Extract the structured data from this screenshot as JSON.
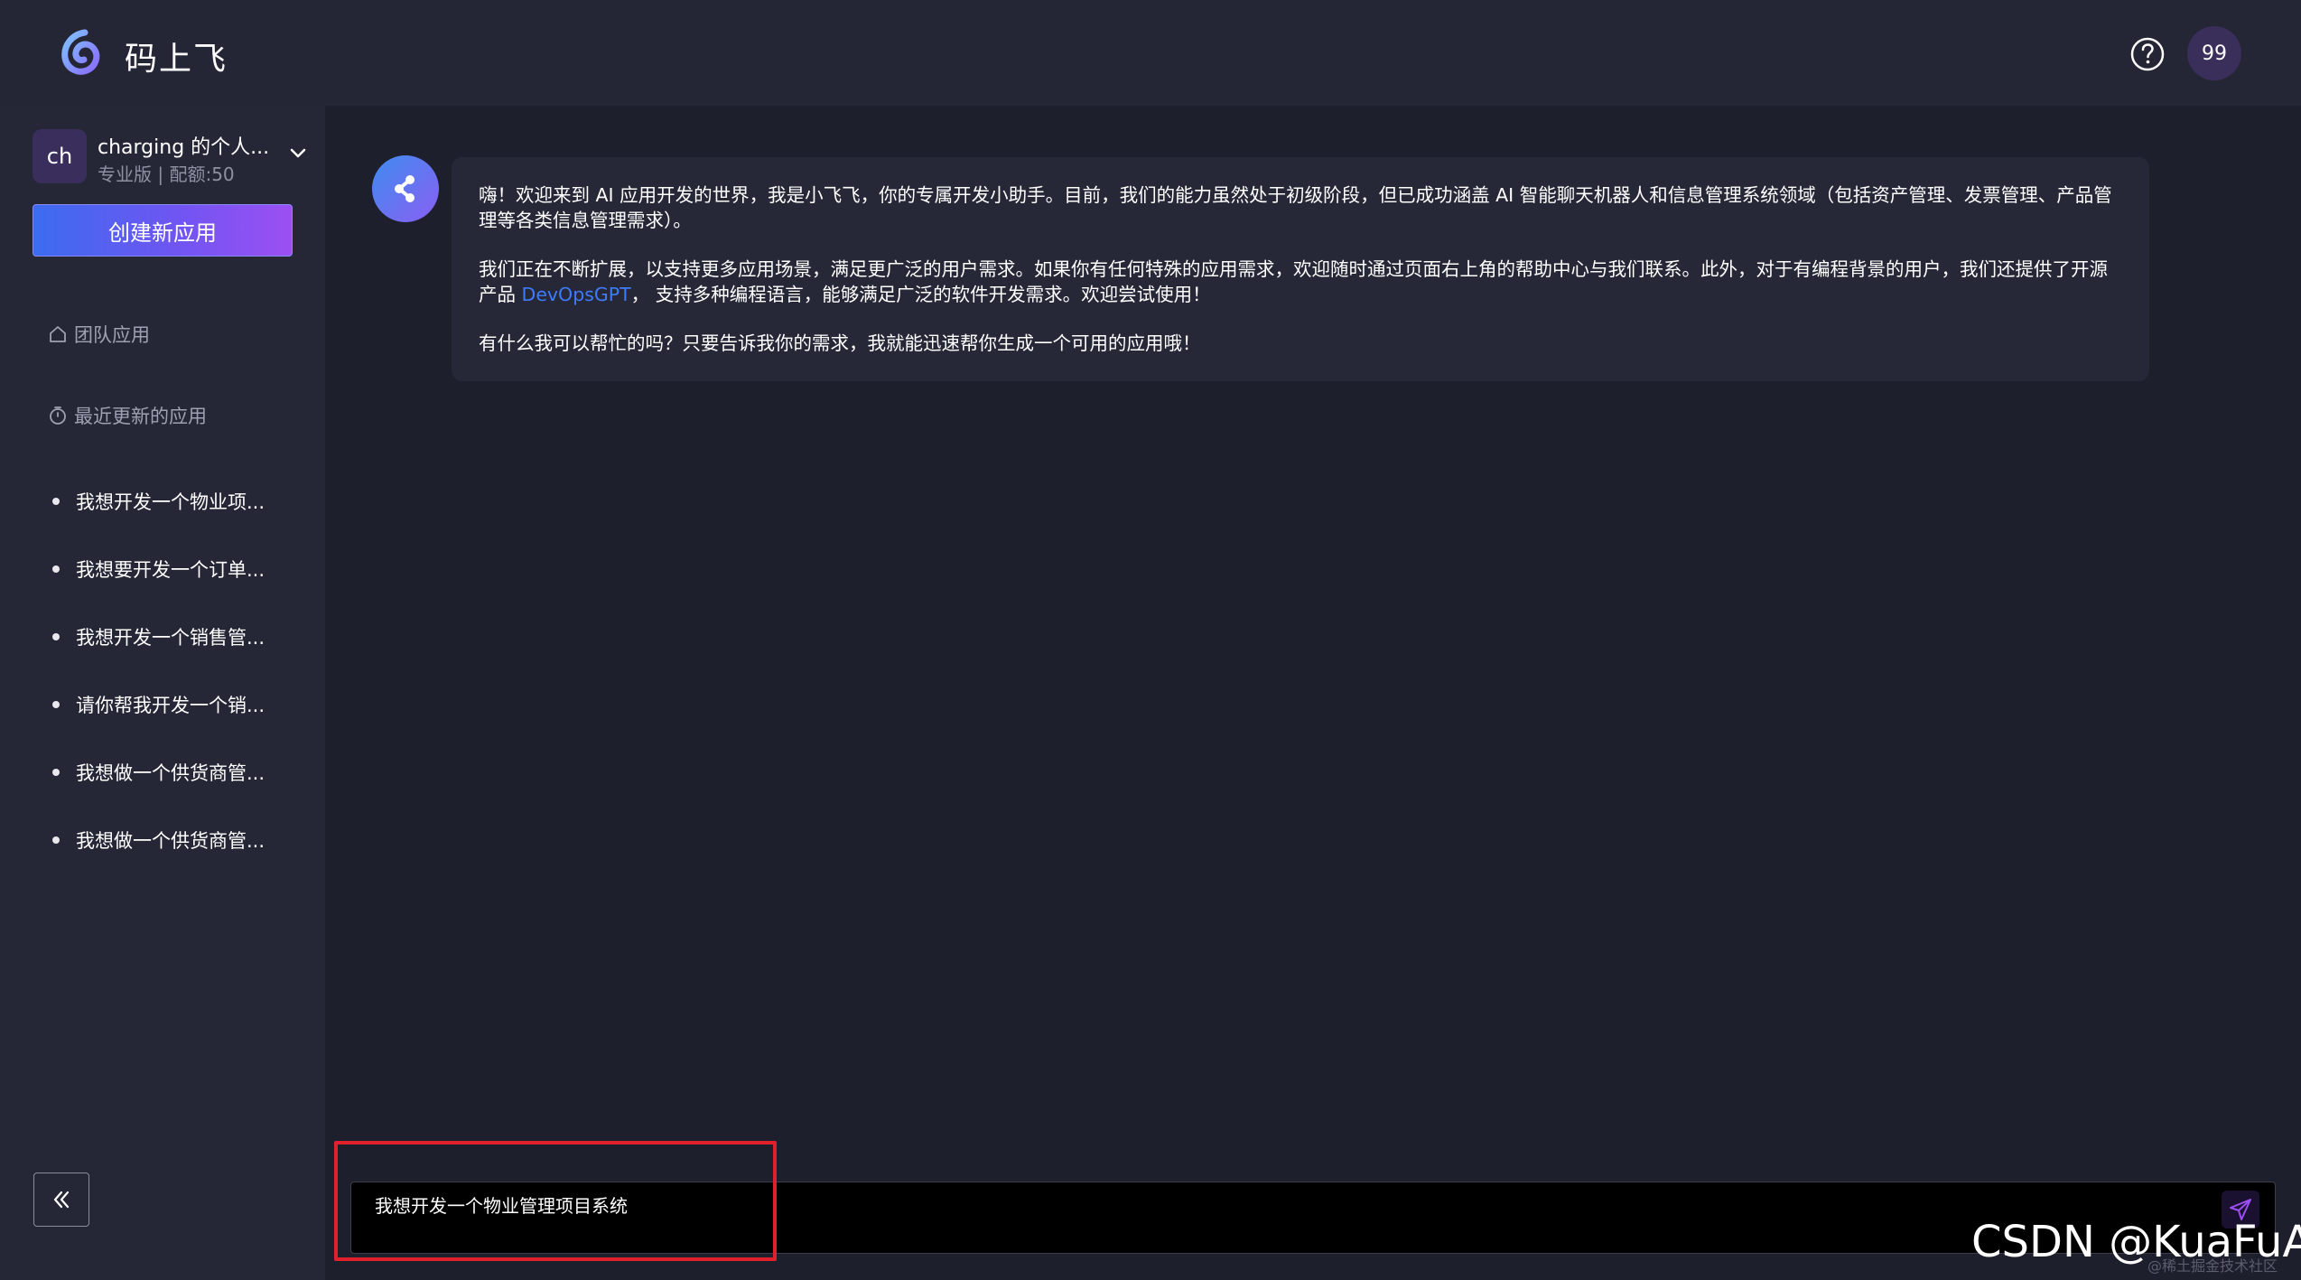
{
  "header": {
    "brand": "码上飞",
    "avatar_text": "99"
  },
  "sidebar": {
    "team": {
      "avatar_text": "ch",
      "name": "charging 的个人...",
      "plan": "专业版 | 配额:50"
    },
    "create_button": "创建新应用",
    "nav": {
      "team_apps": "团队应用",
      "recent_apps": "最近更新的应用"
    },
    "recent_items": [
      "我想开发一个物业项...",
      "我想要开发一个订单...",
      "我想开发一个销售管...",
      "请你帮我开发一个销...",
      "我想做一个供货商管...",
      "我想做一个供货商管..."
    ]
  },
  "chat": {
    "message": {
      "p1": "嗨！欢迎来到 AI 应用开发的世界，我是小飞飞，你的专属开发小助手。目前，我们的能力虽然处于初级阶段，但已成功涵盖 AI 智能聊天机器人和信息管理系统领域（包括资产管理、发票管理、产品管理等各类信息管理需求）。",
      "p2_before": "我们正在不断扩展，以支持更多应用场景，满足更广泛的用户需求。如果你有任何特殊的应用需求，欢迎随时通过页面右上角的帮助中心与我们联系。此外，对于有编程背景的用户，我们还提供了开源产品 ",
      "p2_link": "DevOpsGPT",
      "p2_after": "， 支持多种编程语言，能够满足广泛的软件开发需求。欢迎尝试使用！",
      "p3": "有什么我可以帮忙的吗？只要告诉我你的需求，我就能迅速帮你生成一个可用的应用哦！"
    },
    "input_value": "我想开发一个物业管理项目系统"
  },
  "watermark": {
    "main": "CSDN @KuaFuAI",
    "sub": "@稀土掘金技术社区"
  },
  "colors": {
    "accent_start": "#3b6cf0",
    "accent_end": "#9c4ff2",
    "link": "#3d7bff",
    "highlight": "#e0202a"
  }
}
